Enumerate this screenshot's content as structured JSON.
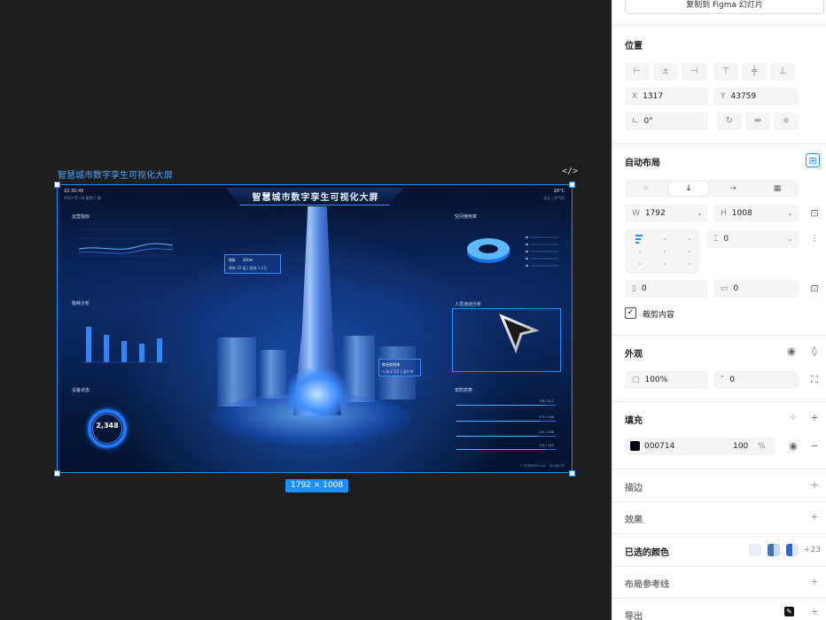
{
  "canvas": {
    "frame_title": "智慧城市数字孪生可视化大屏",
    "size_badge": "1792 × 1008",
    "dashboard": {
      "title": "智慧城市数字孪生可视化大屏",
      "time": "10:30:45",
      "date": "2024-05-28 星期二 晴",
      "temp": "26°C",
      "air": "多云 | 空气优",
      "panels": {
        "left_top": "运营指标",
        "left_mid": "能耗分析",
        "left_bottom": "设备状态",
        "right_top": "空间使用率",
        "right_mid": "人员流动分析",
        "right_bottom": "安防态势"
      },
      "donut_value": "2,348",
      "tooltip": {
        "title": "地标",
        "value": "320m",
        "sub": "建筑 32 层 | 客流 1.1万"
      },
      "tag": {
        "title": "商业综合体",
        "sub": "人流 2.1万 | 运行中"
      },
      "list_values": [
        "756 / 812",
        "374 / 436",
        "234 / 268",
        "128 / 140"
      ],
      "watermark": "© 智慧城市Studio · 设计稿示意"
    }
  },
  "panel": {
    "copy_button": "复制到 Figma 幻灯片",
    "position": {
      "title": "位置",
      "x_label": "X",
      "x_value": "1317",
      "y_label": "Y",
      "y_value": "43759",
      "rotation": "0°"
    },
    "auto_layout": {
      "title": "自动布局",
      "w_label": "W",
      "w_value": "1792",
      "h_label": "H",
      "h_value": "1008",
      "gap_value": "0",
      "pad_h": "0",
      "pad_v": "0",
      "clip_label": "裁剪内容"
    },
    "appearance": {
      "title": "外观",
      "opacity": "100%",
      "radius": "0"
    },
    "fill": {
      "title": "填充",
      "hex": "000714",
      "opacity": "100",
      "percent": "%",
      "color": "#000714"
    },
    "stroke": {
      "title": "描边"
    },
    "effects": {
      "title": "效果"
    },
    "selected_colors": {
      "title": "已选的颜色",
      "more": "+23",
      "chips": [
        "#e9eef7",
        "#3f6fb8",
        "#2a66d9"
      ]
    },
    "layout_guides": {
      "title": "布局参考线"
    },
    "export": {
      "title": "导出"
    }
  },
  "colors": {
    "accent": "#1e8fff",
    "frame_bg": "#030a1d",
    "canvas_bg": "#1e1e1e"
  }
}
